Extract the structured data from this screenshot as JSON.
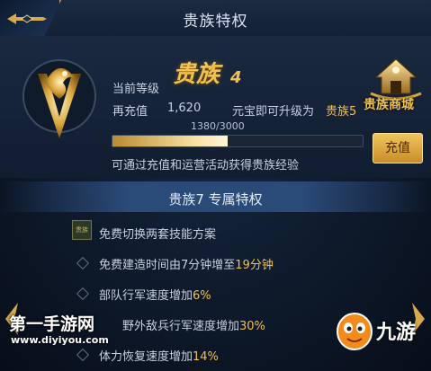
{
  "header": {
    "title": "贵族特权",
    "back_icon": "arrow-back-icon"
  },
  "status": {
    "level_label": "当前等级",
    "level_name": "贵族",
    "level_number": "4",
    "recharge_label": "再充值",
    "recharge_amount": "1,620",
    "recharge_unit": "元宝即可升级为",
    "recharge_target": "贵族5",
    "progress_text": "1380/3000",
    "progress_value": 1380,
    "progress_max": 3000,
    "hint": "可通过充值和运营活动获得贵族经验"
  },
  "shop": {
    "label": "贵族商城",
    "icon": "noble-shop-icon"
  },
  "recharge_button": "充值",
  "privileges": {
    "title": "贵族7  专属特权",
    "badge": "贵族",
    "items": [
      {
        "pre": "免费切换两套技能方案",
        "hi": "",
        "post": ""
      },
      {
        "pre": "免费建造时间由7分钟增至",
        "hi": "19分钟",
        "post": ""
      },
      {
        "pre": "部队行军速度增加",
        "hi": "6%",
        "post": ""
      },
      {
        "pre": "野外敌兵行军速度增加",
        "hi": "30%",
        "post": ""
      },
      {
        "pre": "体力恢复速度增加",
        "hi": "14%",
        "post": ""
      }
    ]
  },
  "watermarks": {
    "left_title": "第一手游网",
    "left_url": "www.diyiyou.com",
    "right_text": "九游"
  },
  "colors": {
    "gold": "#f2c14e",
    "text": "#c7d1e0",
    "background": "#0c1626"
  }
}
